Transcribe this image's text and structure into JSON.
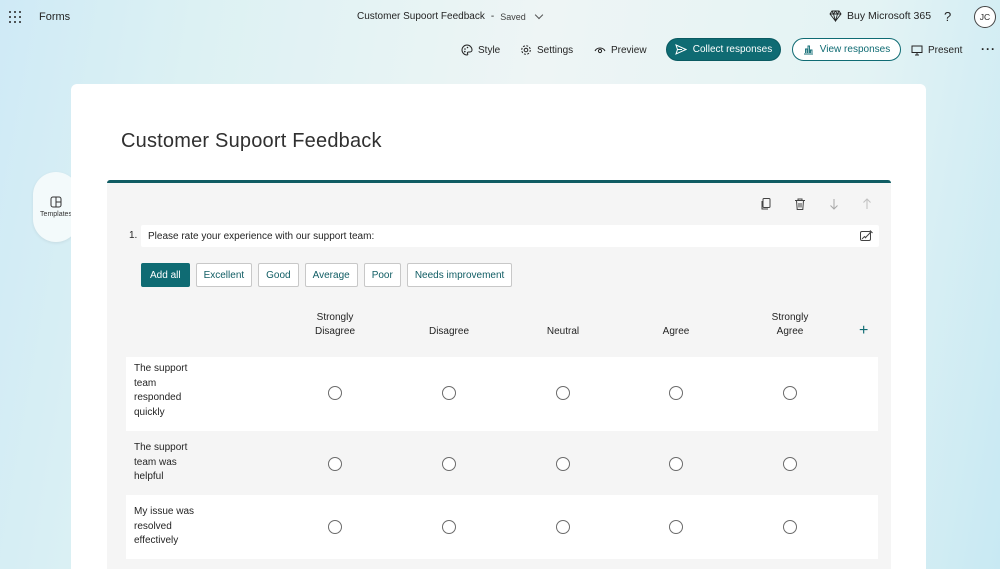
{
  "topbar": {
    "app_name": "Forms",
    "doc_title": "Customer Supoort Feedback",
    "separator": "-",
    "saved": "Saved",
    "buy_label": "Buy Microsoft 365",
    "help": "?",
    "avatar_initials": "JC"
  },
  "commands": {
    "style": "Style",
    "settings": "Settings",
    "preview": "Preview",
    "collect": "Collect responses",
    "view": "View responses",
    "present": "Present",
    "more": "···"
  },
  "sidebar": {
    "templates_label": "Templates"
  },
  "form": {
    "title": "Customer Supoort Feedback",
    "question": {
      "number": "1.",
      "text": "Please rate your experience with our support team:",
      "chips": [
        "Add all",
        "Excellent",
        "Good",
        "Average",
        "Poor",
        "Needs improvement"
      ],
      "columns": [
        {
          "line1": "Strongly",
          "line2": "Disagree"
        },
        {
          "line1": "",
          "line2": "Disagree"
        },
        {
          "line1": "",
          "line2": "Neutral"
        },
        {
          "line1": "",
          "line2": "Agree"
        },
        {
          "line1": "Strongly",
          "line2": "Agree"
        }
      ],
      "rows": [
        {
          "lines": [
            "The support",
            "team",
            "responded",
            "quickly"
          ]
        },
        {
          "lines": [
            "The support",
            "team was",
            "helpful"
          ]
        },
        {
          "lines": [
            "My issue was",
            "resolved",
            "effectively"
          ]
        }
      ]
    }
  },
  "colors": {
    "accent": "#0f6b73",
    "accent_border": "#0f5c63"
  }
}
